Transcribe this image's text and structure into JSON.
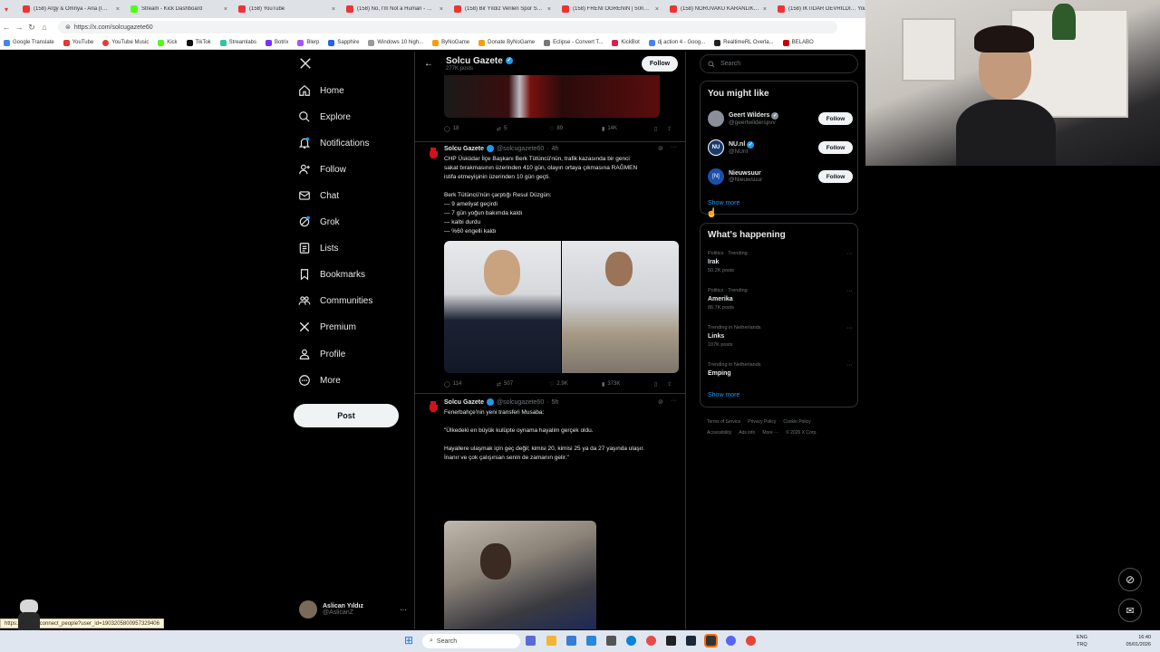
{
  "browser": {
    "tabs": [
      {
        "title": "(158) Argy & Omnya - Aria (I…",
        "color": "#e53935"
      },
      {
        "title": "Stream - Kick Dashboard",
        "color": "#53fc18"
      },
      {
        "title": "(158) YouTube",
        "color": "#e53935"
      },
      {
        "title": "(158) No, I'm Not a Human - Offic",
        "color": "#e53935"
      },
      {
        "title": "(158) Bir Yıldız Verilen Spor Salon…",
        "color": "#e53935"
      },
      {
        "title": "(158) FRENİ ÖĞRENİN | 50riders | …",
        "color": "#e53935"
      },
      {
        "title": "(158) NORUVAKU KARANLIK YÜZ…",
        "color": "#e53935"
      },
      {
        "title": "(158) İKTİDAR DEVRİLDİ… YouT",
        "color": "#e53935"
      }
    ],
    "url": "https://x.com/solcugazete60",
    "bookmarks": [
      "Google Translate",
      "YouTube",
      "YouTube Music",
      "Kick",
      "TikTok",
      "Streamlabs",
      "Botrix",
      "Blerp",
      "Sapphire",
      "Windows 10 high...",
      "ByNoGame",
      "Donate ByNoGame",
      "Eclipse - Convert T...",
      "KickBot",
      "dj action 4 - Goog...",
      "RealtimeRL Overla...",
      "BELABO"
    ],
    "status_url": "https://x.com/i/connect_people?user_id=1903205800957329406"
  },
  "nav": {
    "items": [
      "Home",
      "Explore",
      "Notifications",
      "Follow",
      "Chat",
      "Grok",
      "Lists",
      "Bookmarks",
      "Communities",
      "Premium",
      "Profile",
      "More"
    ],
    "post_label": "Post",
    "account_name": "Aslican Yıldız",
    "account_handle": "@AslicanZ"
  },
  "profile_header": {
    "name": "Solcu Gazete",
    "posts": "277K posts",
    "follow_label": "Follow"
  },
  "tweets": {
    "first_actions": {
      "replies": "18",
      "reposts": "5",
      "likes": "89",
      "views": "14K"
    },
    "t1": {
      "name": "Solcu Gazete",
      "handle": "@solcugazete60",
      "time": "4h",
      "lines": [
        "CHP Üsküdar İlçe Başkanı Berk Tütüncü'nün, trafik kazasında bir genci",
        "sakat bırakmasının üzerinden 410 gün, olayın ortaya çıkmasına RAĞMEN",
        "istifa etmeyişinin üzerinden 10 gün geçti.",
        "",
        "Berk Tütüncü'nün çarptığı Resul Düzgün:",
        "— 9 ameliyat geçirdi",
        "— 7 gün yoğun bakımda kaldı",
        "— kalbi durdu",
        "— %60 engelli kaldı"
      ],
      "replies": "114",
      "reposts": "507",
      "likes": "2.9K",
      "views": "373K"
    },
    "t2": {
      "name": "Solcu Gazete",
      "handle": "@solcugazete60",
      "time": "5h",
      "lines": [
        "Fenerbahçe'nin yeni transferi Musaba:",
        "",
        "\"Ülkedeki en büyük kulüpte oynama hayalim gerçek oldu.",
        "",
        "Hayallere ulaşmak için geç değil; kimisi 20, kimisi 25 ya da 27 yaşında ulaşır.",
        "İnanır ve çok çalışırsan senin de zamanın gelir.\""
      ]
    }
  },
  "search": {
    "placeholder": "Search"
  },
  "suggestions": {
    "title": "You might like",
    "people": [
      {
        "name": "Geert Wilders",
        "handle": "@geertwilderspvv",
        "color": "#8a8f99"
      },
      {
        "name": "NU.nl",
        "handle": "@NUnl",
        "color": "#1a3a6e"
      },
      {
        "name": "Nieuwsuur",
        "handle": "@Nieuwsuur",
        "color": "#1d4fa8"
      }
    ],
    "follow_label": "Follow",
    "show_more": "Show more"
  },
  "trends": {
    "title": "What's happening",
    "items": [
      {
        "context": "Politics · Trending",
        "name": "Irak",
        "posts": "50.2K posts"
      },
      {
        "context": "Politics · Trending",
        "name": "Amerika",
        "posts": "86.7K posts"
      },
      {
        "context": "Trending in Netherlands",
        "name": "Links",
        "posts": "107K posts"
      },
      {
        "context": "Trending in Netherlands",
        "name": "Emping",
        "posts": ""
      }
    ],
    "show_more": "Show more"
  },
  "footer": {
    "links": [
      "Terms of Service",
      "Privacy Policy",
      "Cookie Policy",
      "Accessibility",
      "Ads info",
      "More ···",
      "© 2026 X Corp."
    ]
  },
  "taskbar": {
    "search": "Search",
    "lang": [
      "ENG",
      "TRQ"
    ],
    "time": "16:40",
    "date": "05/01/2026"
  },
  "colors": {
    "accent": "#1d9bf0",
    "bg": "#000000",
    "border": "#2f3336"
  }
}
